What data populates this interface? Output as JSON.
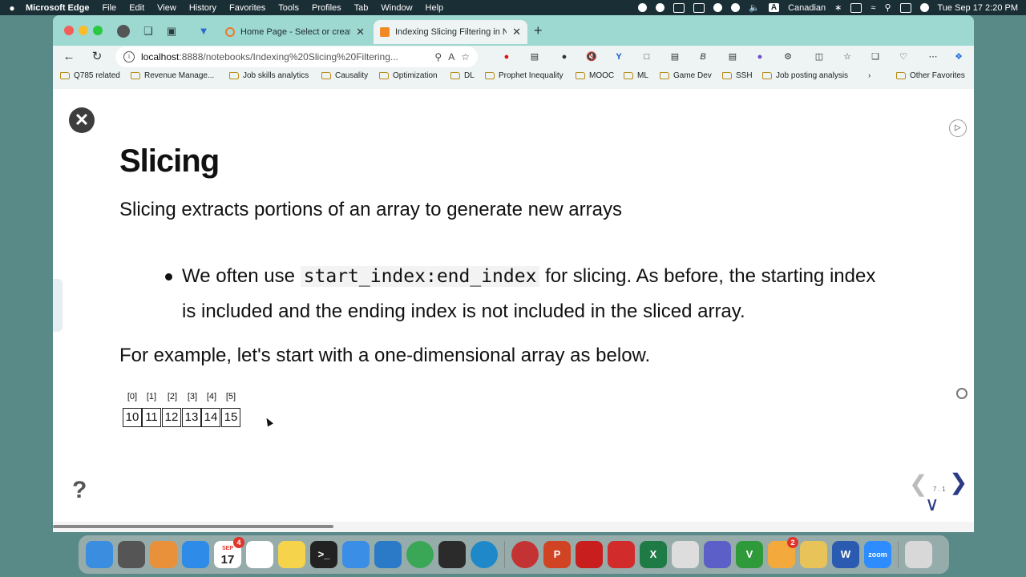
{
  "menubar": {
    "app_name": "Microsoft Edge",
    "items": [
      "File",
      "Edit",
      "View",
      "History",
      "Favorites",
      "Tools",
      "Profiles",
      "Tab",
      "Window",
      "Help"
    ],
    "input_source": "Canadian",
    "input_badge": "A",
    "datetime": "Tue Sep 17  2:20 PM"
  },
  "browser": {
    "tabs": [
      {
        "title": "Home Page - Select or create a",
        "color": "#e87a2c"
      },
      {
        "title": "Indexing Slicing Filtering in Nun",
        "color": "#f08a24"
      }
    ],
    "address": {
      "host": "localhost",
      "path": ":8888/notebooks/Indexing%20Slicing%20Filtering..."
    },
    "bookmarks": [
      "Q785 related",
      "Revenue Manage...",
      "Job skills analytics",
      "Causality",
      "Optimization",
      "DL",
      "Prophet Inequality",
      "MOOC",
      "ML",
      "Game Dev",
      "SSH",
      "Job posting analysis"
    ],
    "bookmarks_other": "Other Favorites"
  },
  "slide": {
    "title": "Slicing",
    "subtitle": "Slicing extracts portions of an array to generate new arrays",
    "bullet_pre": "We often use ",
    "bullet_code": "start_index:end_index",
    "bullet_post": " for slicing. As before, the starting index is included and the ending index is not included in the sliced array.",
    "example": "For example, let's start with a one-dimensional array as below.",
    "array_indices": [
      "[0]",
      "[1]",
      "[2]",
      "[3]",
      "[4]",
      "[5]"
    ],
    "array_values": [
      "10",
      "11",
      "12",
      "13",
      "14",
      "15"
    ],
    "slide_number": "7 . 1"
  },
  "dock": {
    "apps": [
      {
        "name": "finder",
        "color": "#3b8de0",
        "label": ""
      },
      {
        "name": "calculator",
        "color": "#555555",
        "label": ""
      },
      {
        "name": "launchpad",
        "color": "#e8913a",
        "label": ""
      },
      {
        "name": "safari",
        "color": "#2f8be8",
        "label": ""
      },
      {
        "name": "calendar",
        "color": "#ffffff",
        "label": "17"
      },
      {
        "name": "reminders",
        "color": "#ffffff",
        "label": ""
      },
      {
        "name": "notes",
        "color": "#f5d34a",
        "label": ""
      },
      {
        "name": "terminal",
        "color": "#222222",
        "label": ">_"
      },
      {
        "name": "mail",
        "color": "#3a8ee6",
        "label": ""
      },
      {
        "name": "vscode",
        "color": "#2a7ac8",
        "label": ""
      },
      {
        "name": "chrome",
        "color": "#3aa757",
        "label": ""
      },
      {
        "name": "activity-monitor",
        "color": "#2b2b2b",
        "label": ""
      },
      {
        "name": "edge",
        "color": "#1e88c8",
        "label": ""
      },
      {
        "name": "crossover",
        "color": "#c43333",
        "label": ""
      },
      {
        "name": "powerpoint",
        "color": "#d04423",
        "label": "P"
      },
      {
        "name": "acrobat-1",
        "color": "#c81e1e",
        "label": ""
      },
      {
        "name": "acrobat-2",
        "color": "#d12b2b",
        "label": ""
      },
      {
        "name": "excel",
        "color": "#1f7b45",
        "label": "X"
      },
      {
        "name": "textedit",
        "color": "#dddddd",
        "label": ""
      },
      {
        "name": "teams",
        "color": "#5b5fc7",
        "label": ""
      },
      {
        "name": "vim",
        "color": "#2e9a3a",
        "label": "V"
      },
      {
        "name": "photos",
        "color": "#f3a93c",
        "label": ""
      },
      {
        "name": "notes-pencil",
        "color": "#e8c35a",
        "label": ""
      },
      {
        "name": "word",
        "color": "#2b5bb0",
        "label": "W"
      },
      {
        "name": "zoom",
        "color": "#2d8cff",
        "label": "zoom"
      },
      {
        "name": "trash",
        "color": "#d8d8d8",
        "label": ""
      }
    ],
    "calendar_month": "SEP",
    "calendar_badge": "4",
    "photos_badge": "2"
  }
}
